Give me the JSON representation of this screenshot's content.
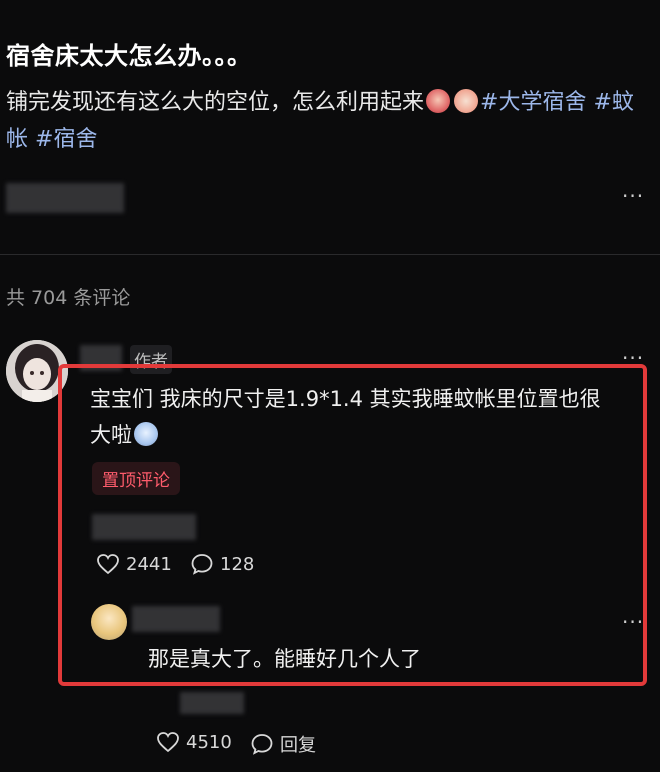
{
  "post": {
    "title": "宿舍床太大怎么办。。。",
    "body_text": "铺完发现还有这么大的空位，怎么利用起来",
    "hashtags": [
      "#大学宿舍",
      "#蚊帐",
      "#宿舍"
    ],
    "emoji_icons": [
      "blushing-face-icon",
      "embarrassed-face-icon"
    ]
  },
  "comments_header": {
    "count_text": "共 704 条评论"
  },
  "top_comment": {
    "author_tag": "作者",
    "text_line1": "宝宝们 我床的尺寸是1.9*1.4 其实我睡蚊帐里位置也很",
    "text_line2": "大啦",
    "badge": "置顶评论",
    "likes": "2441",
    "replies": "128"
  },
  "reply": {
    "text": "那是真大了。能睡好几个人了"
  },
  "bottom_stats": {
    "likes": "4510",
    "reply_label": "回复"
  },
  "menu_more_label": "···",
  "colors": {
    "background": "#0b0b0c",
    "hashtag": "#9cb7ea",
    "highlight_box": "#e23a3a",
    "pin_badge": "#ff5c6c"
  }
}
